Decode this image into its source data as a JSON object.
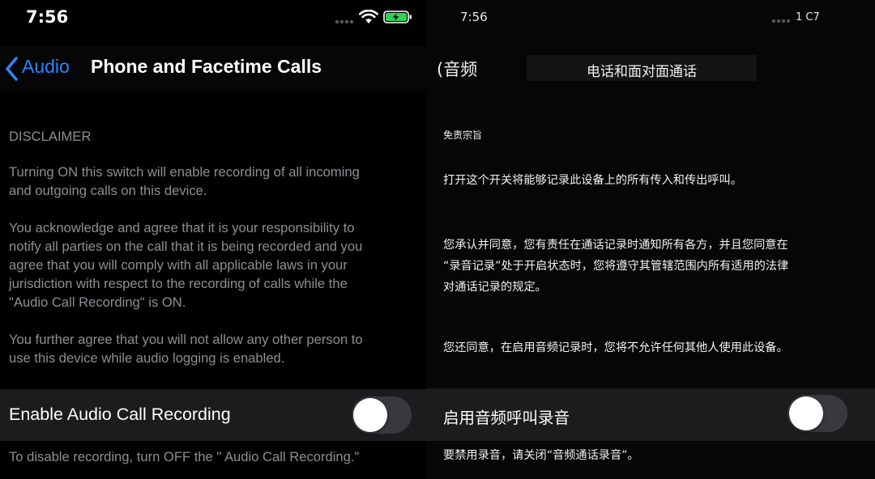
{
  "left": {
    "status": {
      "time": "7:56",
      "icons": [
        "signal-dots-icon",
        "wifi-icon",
        "battery-charging-icon"
      ],
      "battery_color": "#30d158"
    },
    "nav": {
      "back_label": "Audio",
      "title": "Phone and Facetime Calls",
      "accent_color": "#2a86ff"
    },
    "disclaimer": {
      "heading": "DISCLAIMER",
      "p1": [
        "Turning ON this switch will enable recording of all incoming",
        "and outgoing calls on this device."
      ],
      "p2": [
        "You acknowledge and agree that it is your responsibility to",
        "notify all parties on the call that it is being recorded and you",
        "agree that you will comply with all applicable laws in your",
        "jurisdiction with respect to the recording of calls while the",
        "\"Audio Call Recording\" is ON."
      ],
      "p3": [
        "You further agree that you will not allow any other person to",
        "use this device while audio logging is enabled."
      ]
    },
    "setting": {
      "label": "Enable Audio Call Recording",
      "enabled": false
    },
    "footer": "To disable recording, turn OFF the \" Audio Call Recording.\""
  },
  "right": {
    "status": {
      "time": "7:56",
      "carrier": "1 C7",
      "icons": [
        "signal-dots-icon"
      ]
    },
    "nav": {
      "back_label": "(音频",
      "title": "电话和面对面通话"
    },
    "disclaimer": {
      "heading": "免责宗旨",
      "p1": [
        "打开这个开关将能够记录此设备上的所有传入和传出呼叫。"
      ],
      "p2": [
        "您承认并同意，您有责任在通话记录时通知所有各方，并且您同意在",
        "“录音记录”处于开启状态时，您将遵守其管辖范围内所有适用的法律",
        "对通话记录的规定。"
      ],
      "p3": [
        "您还同意，在启用音频记录时，您将不允许任何其他人使用此设备。"
      ]
    },
    "setting": {
      "label": "启用音频呼叫录音",
      "enabled": false
    },
    "footer": "要禁用录音，请关闭“音频通话录音”。"
  }
}
